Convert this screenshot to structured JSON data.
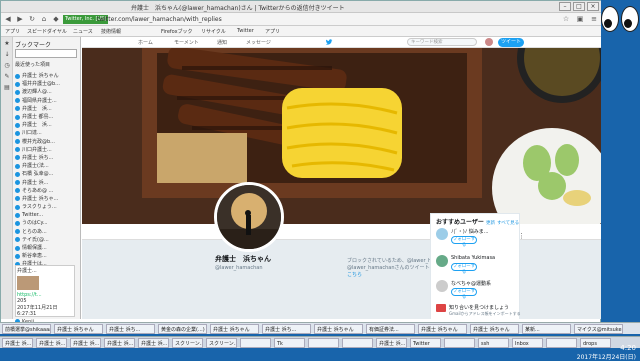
{
  "window": {
    "title": "弁護士　浜ちゃん(@lawer_hamachan)さん | Twitterからの返信付きツイート",
    "controls": [
      "–",
      "□",
      "×"
    ]
  },
  "urlbar": {
    "secure_label": "Twitter, Inc. [US]",
    "url": "twitter.com/lawer_hamachan/with_replies"
  },
  "bookmarks": [
    "アプリ",
    "スピードダイヤル",
    "ニュース",
    "技術情報",
    "Firefoxブック",
    "リサイクル",
    "Twitter",
    "アプリ"
  ],
  "sidebar": {
    "header": "ブックマーク",
    "folder": "最近使った項目",
    "items": [
      "弁護士 浜ちゃん",
      "福井弁護士@b...",
      "渡辺輝人@...",
      "福岡県弁護士...",
      "弁護士　浜...",
      "弁護士 都島...",
      "弁護士　浜...",
      "川口達...",
      "櫻井光政@b...",
      "川口弁護士...",
      "弁護士 浜ち...",
      "弁護士(法...",
      "石橋 弘幸@...",
      "弁護士 浜...",
      "そらあめ@ ...",
      "弁護士 浜ちゃ...",
      "ラスクりょう...",
      "Twitter...",
      "うのはCy...",
      "とらのあ...",
      "テイ氏(@...",
      "情報保護...",
      "新谷幸恵...",
      "弁護士は...",
      "弁護士日...",
      "Shibata...",
      "弁護士 浜ちゃ...",
      "弁護士 浜...",
      "國谷寿@...",
      "らみoa...",
      "Kenji..."
    ],
    "preview": {
      "title": "弁護士...",
      "link": "https://t...",
      "count": "205",
      "date": "2017年11月21日 6:27:31"
    }
  },
  "twitter": {
    "nav": [
      "ホーム",
      "モーメント",
      "通知",
      "メッセージ"
    ],
    "search_placeholder": "キーワード検索",
    "tweet_label": "ツイート"
  },
  "profile": {
    "name": "弁護士　浜ちゃん",
    "handle": "@lawer_hamachan",
    "protected_text": "ブロックされているため、@lawer_hamachanさんのフォローや@lawer_hamachanさんのツイートの表示はできません。",
    "protected_link": "詳細はこちら",
    "more": "⋮"
  },
  "who_to_follow": {
    "title": "おすすめユーザー",
    "refresh": "更新",
    "view_all": "すべて見る",
    "follow_label": "フォローする",
    "users": [
      {
        "name": "ﾉ(ﾞ・)ﾉ 悩みま...",
        "color": "#9ccde8"
      },
      {
        "name": "Shibata Yukimasa",
        "color": "#6a8"
      },
      {
        "name": "なべちゃ@運動系",
        "color": "#ccc"
      }
    ],
    "contacts": "知り合いを見つけましょう",
    "contacts_sub": "Gmailからアドレス帳をインポートする"
  },
  "taskbar": {
    "row1": [
      "前橋選挙@shikaaaaa2...",
      "弁護士 浜ちゃん",
      "弁護士 浜ち...",
      "黄金の森の企業(...)",
      "弁護士 浜ちゃん",
      "弁護士 浜ち...",
      "弁護士 浜ちゃん",
      "有価証券法...",
      "弁護士 浜ちゃん",
      "弁護士 浜ちゃん",
      "某新...",
      "マイクス@mitsuke..."
    ],
    "row2": [
      "弁護士 浜...",
      "弁護士 浜...",
      "弁護士 浜...",
      "弁護士 浜...",
      "弁護士 浜...",
      "スクリーン...",
      "スクリーン...",
      "",
      "Tk",
      "",
      "",
      "弁護士 浜...",
      "Twitter",
      "",
      "ssh",
      "Inbox",
      "",
      "drops"
    ]
  },
  "clock": {
    "time": "4:20",
    "date": "2017年12月24日(日)"
  },
  "colors": {
    "twitter_blue": "#1da1f2",
    "link": "#1b95e0",
    "bg": "#e6ecf0"
  }
}
